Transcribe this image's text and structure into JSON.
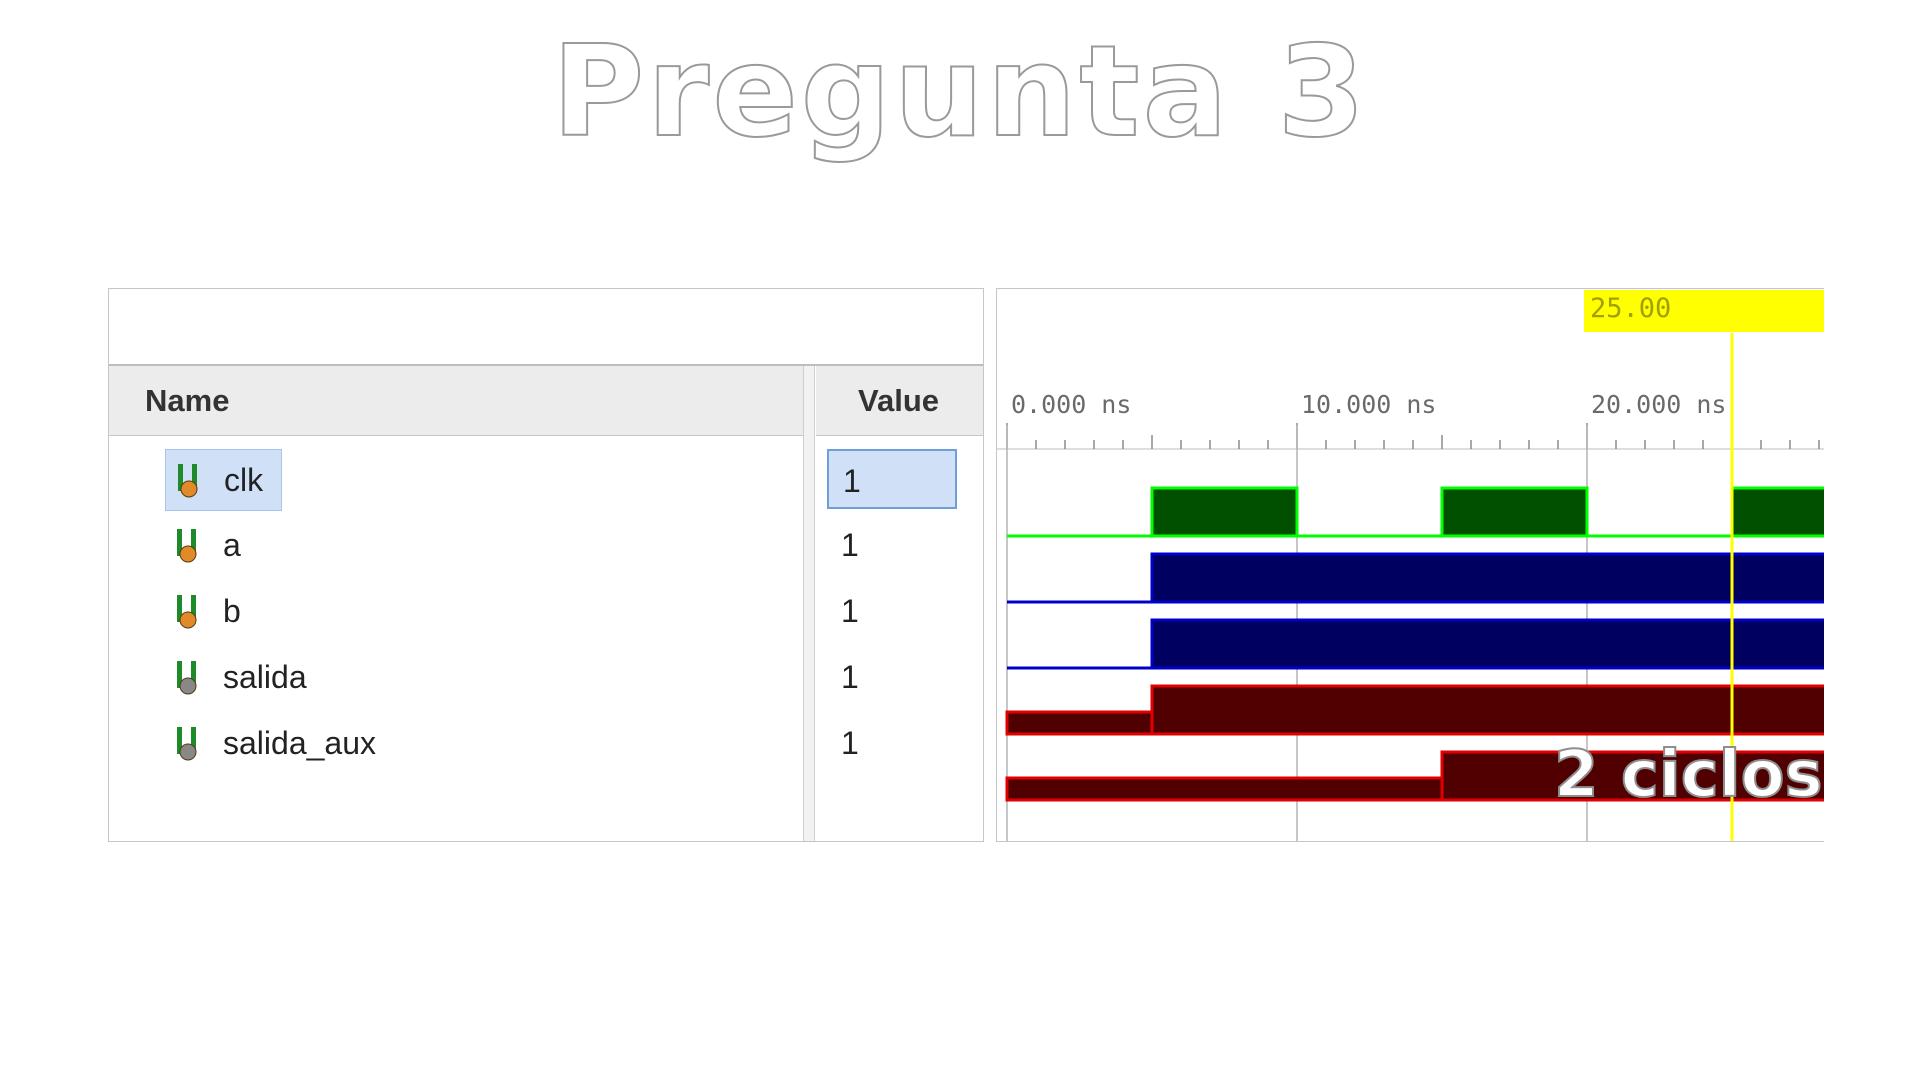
{
  "slide": {
    "title": "Pregunta 3",
    "annotation": "2 ciclos"
  },
  "table": {
    "name_header": "Name",
    "value_header": "Value",
    "signals": [
      {
        "name": "clk",
        "value": "1",
        "selected": true,
        "icon": "input-port-icon"
      },
      {
        "name": "a",
        "value": "1",
        "selected": false,
        "icon": "input-port-icon"
      },
      {
        "name": "b",
        "value": "1",
        "selected": false,
        "icon": "input-port-icon"
      },
      {
        "name": "salida",
        "value": "1",
        "selected": false,
        "icon": "output-port-icon"
      },
      {
        "name": "salida_aux",
        "value": "1",
        "selected": false,
        "icon": "output-port-icon"
      }
    ]
  },
  "timeline": {
    "ticks": [
      "0.000 ns",
      "10.000 ns",
      "20.000 ns"
    ],
    "cursor_label": "25.00",
    "cursor_color": "#ffff00"
  },
  "waves": {
    "clk": {
      "color": "#00ff00",
      "fill": "#005000",
      "high": [
        [
          5,
          10
        ],
        [
          15,
          20
        ],
        [
          25,
          30
        ]
      ]
    },
    "a": {
      "color": "#0000c8",
      "fill": "#000060",
      "high": [
        [
          5,
          30
        ]
      ]
    },
    "b": {
      "color": "#0000c8",
      "fill": "#000060",
      "high": [
        [
          5,
          30
        ]
      ]
    },
    "salida": {
      "color": "#e00000",
      "fill": "#500000",
      "low_bus": [
        [
          0,
          5
        ]
      ],
      "high": [
        [
          5,
          30
        ]
      ]
    },
    "salida_aux": {
      "color": "#e00000",
      "fill": "#500000",
      "low_bus": [
        [
          0,
          15
        ]
      ],
      "high": [
        [
          15,
          30
        ]
      ]
    }
  }
}
